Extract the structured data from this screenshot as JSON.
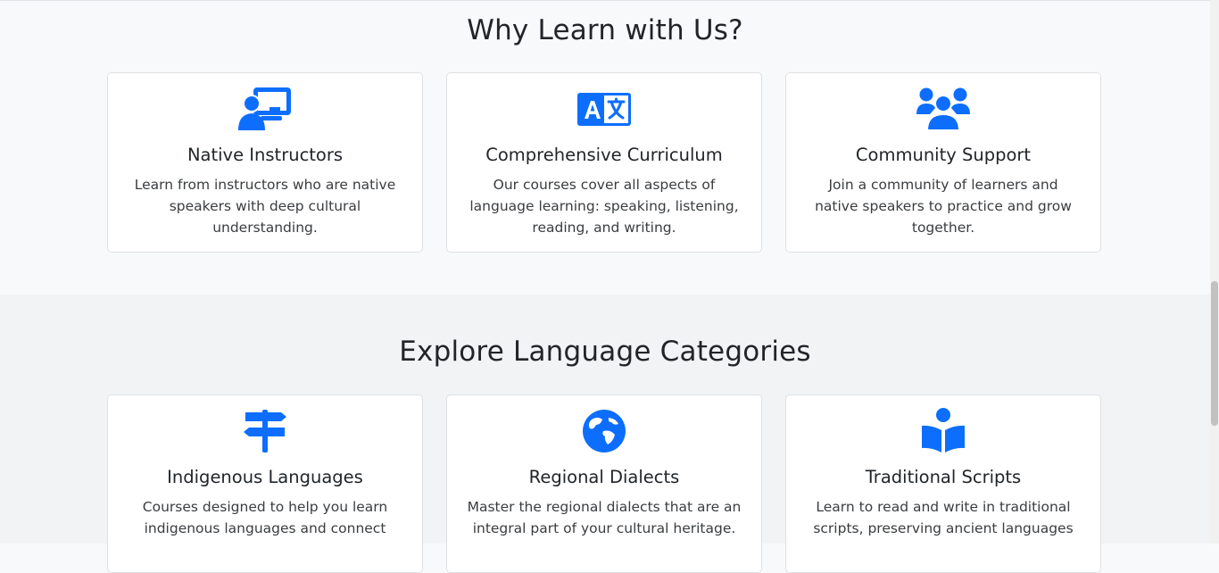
{
  "colors": {
    "accent": "#0d6efd",
    "background": "#f8f9fa",
    "card_border": "#dfe1e4"
  },
  "why": {
    "title": "Why Learn with Us?",
    "cards": [
      {
        "icon": "chalkboard-teacher-icon",
        "title": "Native Instructors",
        "text": "Learn from instructors who are native speakers with deep cultural understanding."
      },
      {
        "icon": "language-icon",
        "title": "Comprehensive Curriculum",
        "text": "Our courses cover all aspects of language learning: speaking, listening, reading, and writing."
      },
      {
        "icon": "users-icon",
        "title": "Community Support",
        "text": "Join a community of learners and native speakers to practice and grow together."
      }
    ]
  },
  "explore": {
    "title": "Explore Language Categories",
    "cards": [
      {
        "icon": "signpost-icon",
        "title": "Indigenous Languages",
        "text": "Courses designed to help you learn indigenous languages and connect"
      },
      {
        "icon": "globe-icon",
        "title": "Regional Dialects",
        "text": "Master the regional dialects that are an integral part of your cultural heritage."
      },
      {
        "icon": "book-reader-icon",
        "title": "Traditional Scripts",
        "text": "Learn to read and write in traditional scripts, preserving ancient languages"
      }
    ]
  }
}
